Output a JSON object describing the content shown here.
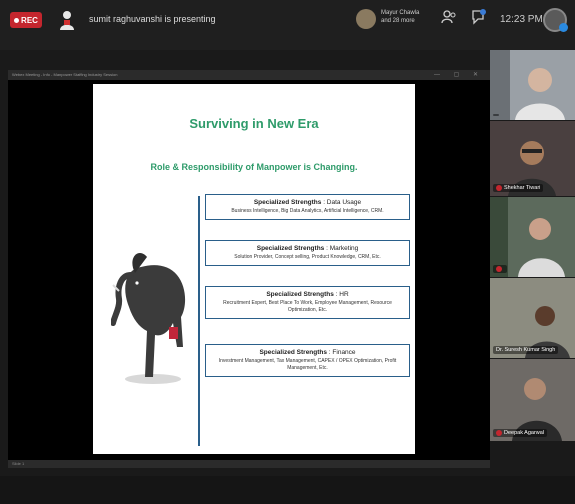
{
  "topbar": {
    "rec_label": "REC",
    "presenting_text": "sumit raghuvanshi is presenting",
    "attendee_name": "Mayur Chawla",
    "attendee_sub": "and 28 more",
    "time": "12:23 PM"
  },
  "share_window": {
    "title_text": "Webex Meeting - Info - Manpower Staffing Industry Session",
    "status_text": "Slide 1"
  },
  "slide": {
    "title": "Surviving in New Era",
    "subtitle": "Role & Responsibility of Manpower is Changing.",
    "boxes": [
      {
        "head": "Specialized Strengths",
        "area": " : Data Usage",
        "desc": "Business Intelligence, Big Data Analytics, Artificial Intelligence, CRM."
      },
      {
        "head": "Specialized Strengths",
        "area": " : Marketing",
        "desc": "Solution Provider, Concept selling, Product Knowledge, CRM, Etc."
      },
      {
        "head": "Specialized Strengths",
        "area": " : HR",
        "desc": "Recruitment Expert, Best Place To Work, Employee Management, Resource Optimization, Etc."
      },
      {
        "head": "Specialized Strengths",
        "area": " : Finance",
        "desc": "Investment Management, Tax Management, CAPEX / OPEX Optimization, Profit Management, Etc."
      }
    ]
  },
  "participants": [
    {
      "name": ""
    },
    {
      "name": "Shekhar Tiwari"
    },
    {
      "name": ""
    },
    {
      "name": "Dr. Suresh Kumar Singh"
    },
    {
      "name": "Deepak Agarwal"
    }
  ],
  "colors": {
    "accent_green": "#2e9b6a",
    "box_border": "#2a5f8a",
    "rec_red": "#c4262e"
  }
}
